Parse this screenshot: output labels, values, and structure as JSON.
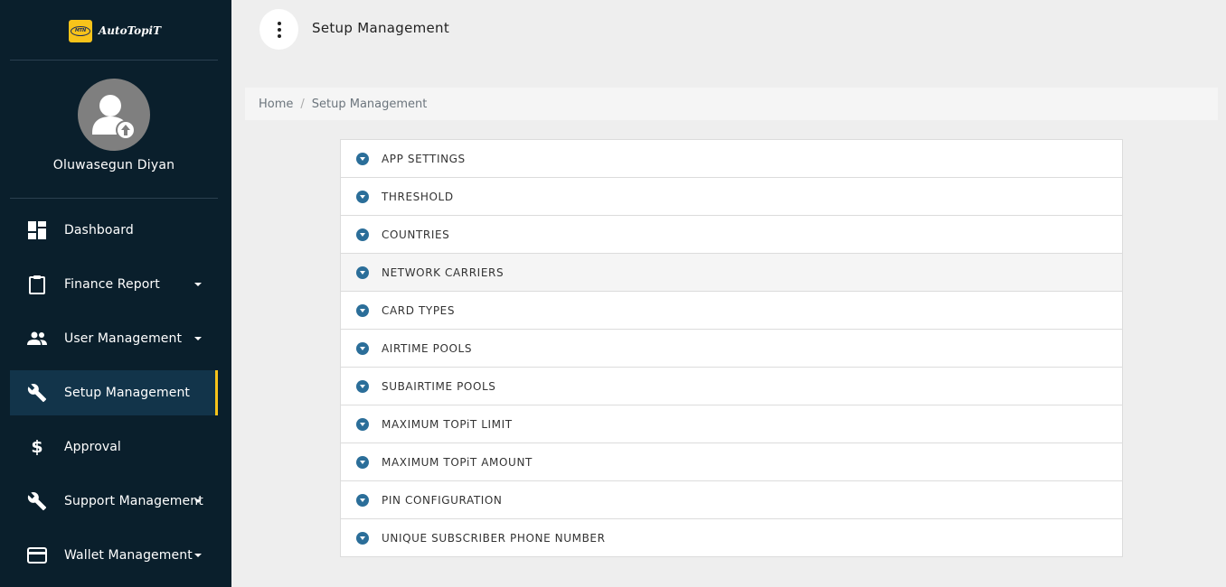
{
  "brand": {
    "logo_text": "MTN",
    "name": "AutoTopiT"
  },
  "user": {
    "name": "Oluwasegun Diyan"
  },
  "sidebar": {
    "items": [
      {
        "label": "Dashboard",
        "icon": "dashboard-icon",
        "has_caret": false,
        "active": false
      },
      {
        "label": "Finance Report",
        "icon": "clipboard-icon",
        "has_caret": true,
        "active": false
      },
      {
        "label": "User Management",
        "icon": "people-icon",
        "has_caret": true,
        "active": false
      },
      {
        "label": "Setup Management",
        "icon": "wrench-icon",
        "has_caret": false,
        "active": true
      },
      {
        "label": "Approval",
        "icon": "dollar-icon",
        "has_caret": false,
        "active": false
      },
      {
        "label": "Support Management",
        "icon": "wrench-icon",
        "has_caret": true,
        "active": false
      },
      {
        "label": "Wallet Management",
        "icon": "credit-card-icon",
        "has_caret": true,
        "active": false
      }
    ]
  },
  "header": {
    "title": "Setup Management"
  },
  "breadcrumb": {
    "home": "Home",
    "separator": "/",
    "current": "Setup Management"
  },
  "accordion": {
    "items": [
      {
        "label": "APP SETTINGS"
      },
      {
        "label": "THRESHOLD"
      },
      {
        "label": "COUNTRIES"
      },
      {
        "label": "NETWORK CARRIERS"
      },
      {
        "label": "CARD TYPES"
      },
      {
        "label": "AIRTIME POOLS"
      },
      {
        "label": "SUBAIRTIME POOLS"
      },
      {
        "label": "MAXIMUM TOPiT LIMIT"
      },
      {
        "label": "MAXIMUM TOPiT AMOUNT"
      },
      {
        "label": "PIN CONFIGURATION"
      },
      {
        "label": "UNIQUE SUBSCRIBER PHONE NUMBER"
      }
    ]
  },
  "colors": {
    "sidebar_bg": "#0a1f2c",
    "active_bg": "#12344a",
    "accent": "#f7c31a",
    "accordion_icon": "#2b6e99"
  }
}
